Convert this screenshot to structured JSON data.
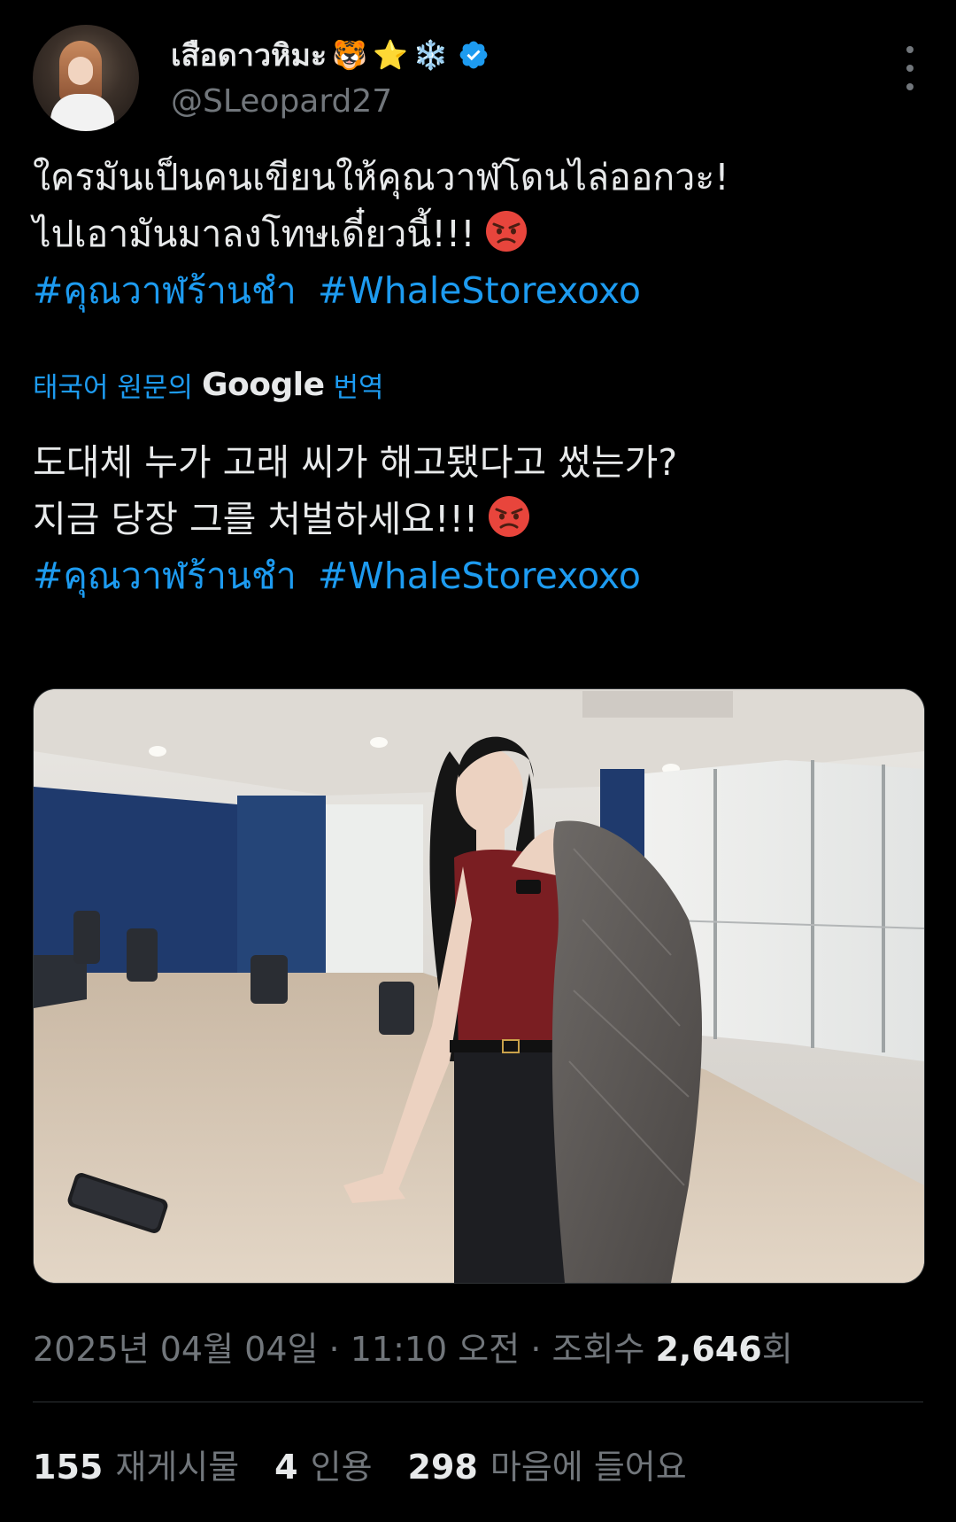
{
  "author": {
    "display_name": "เสือดาวหิมะ",
    "name_emojis": [
      "🐯",
      "⭐",
      "❄️"
    ],
    "handle": "@SLeopard27",
    "verified": true
  },
  "tweet": {
    "lines": [
      "ใครมันเป็นคนเขียนให้คุณวาฬโดนไล่ออกวะ!",
      "ไปเอามันมาลงโทษเดี๋ยวนี้!!!"
    ],
    "hashtags": [
      "#คุณวาฬร้านชำ",
      "#WhaleStorexoxo"
    ]
  },
  "translation": {
    "prefix": "태국어 원문의",
    "provider": "Google",
    "suffix": "번역",
    "lines": [
      "도대체 누가 고래 씨가 해고됐다고 썼는가?",
      "지금 당장 그를 처벌하세요!!!"
    ],
    "hashtags": [
      "#คุณวาฬร้านชำ",
      "#WhaleStorexoxo"
    ]
  },
  "media": {
    "type": "photo"
  },
  "meta": {
    "date": "2025년 04월 04일",
    "time": "11:10 오전",
    "views_label": "조회수",
    "views_count": "2,646",
    "views_suffix": "회"
  },
  "stats": {
    "retweets": "155",
    "retweets_label": "재게시물",
    "quotes": "4",
    "quotes_label": "인용",
    "likes": "298",
    "likes_label": "마음에 들어요"
  },
  "colors": {
    "background": "#000000",
    "text": "#e7e9ea",
    "muted": "#71767b",
    "accent": "#1d9bf0",
    "divider": "#2f3336"
  }
}
